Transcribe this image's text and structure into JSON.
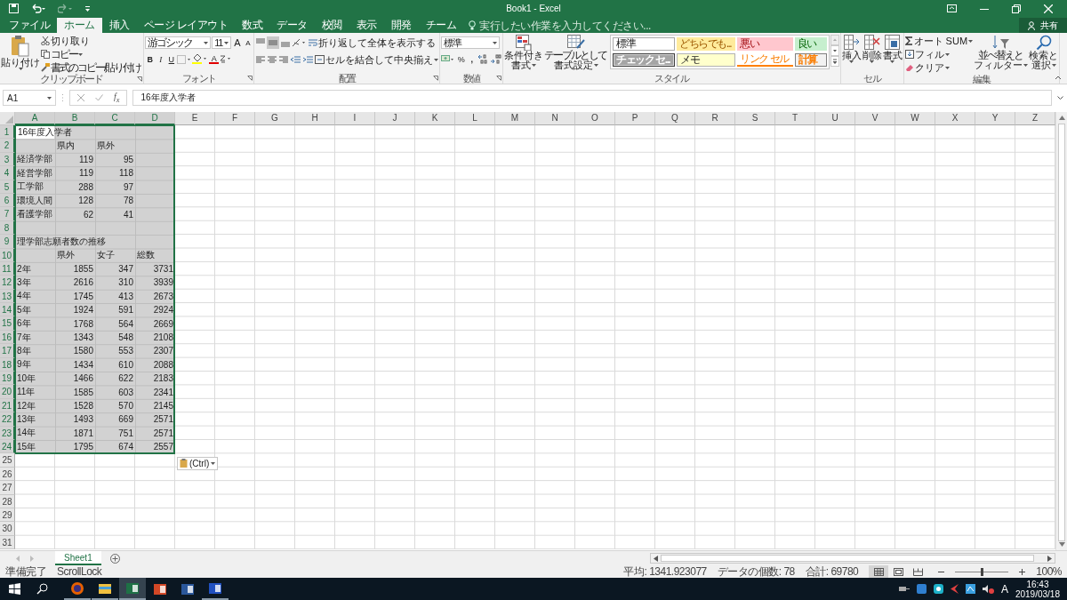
{
  "title_bar": {
    "title": "Book1 - Excel",
    "redo_disabled": true
  },
  "tabs": [
    {
      "label": "ファイル",
      "selected": false
    },
    {
      "label": "ホーム",
      "selected": true
    },
    {
      "label": "挿入",
      "selected": false
    },
    {
      "label": "ページ レイアウト",
      "selected": false
    },
    {
      "label": "数式",
      "selected": false
    },
    {
      "label": "データ",
      "selected": false
    },
    {
      "label": "校閲",
      "selected": false
    },
    {
      "label": "表示",
      "selected": false
    },
    {
      "label": "開発",
      "selected": false
    },
    {
      "label": "チーム",
      "selected": false
    }
  ],
  "tell_me": {
    "placeholder": "実行したい作業を入力してください..."
  },
  "share": {
    "label": "共有"
  },
  "ribbon": {
    "clipboard": {
      "label": "クリップボード",
      "paste": "貼り付け",
      "cut": "切り取り",
      "copy": "コピー",
      "format_painter": "書式のコピー/貼り付け"
    },
    "font": {
      "label": "フォント",
      "font_name": "游ゴシック",
      "font_size": "11",
      "grow": "A",
      "shrink": "A",
      "bold": "B",
      "italic": "I",
      "underline": "U",
      "font_color": "A"
    },
    "alignment": {
      "label": "配置",
      "wrap": "折り返して全体を表示する",
      "merge": "セルを結合して中央揃え"
    },
    "number": {
      "label": "数値",
      "format": "標準",
      "percent": "%",
      "comma": ","
    },
    "styles": {
      "label": "スタイル",
      "conditional": [
        "条件付き",
        "書式"
      ],
      "table": [
        "テーブルとして",
        "書式設定"
      ],
      "gallery": [
        {
          "label": "標準",
          "kind": "normal"
        },
        {
          "label": "どちらでも...",
          "kind": "neutral"
        },
        {
          "label": "悪い",
          "kind": "bad"
        },
        {
          "label": "良い",
          "kind": "good"
        },
        {
          "label": "チェック セ...",
          "kind": "check"
        },
        {
          "label": "メモ",
          "kind": "note"
        },
        {
          "label": "リンク セル",
          "kind": "link"
        },
        {
          "label": "計算",
          "kind": "calc"
        }
      ]
    },
    "cells": {
      "label": "セル",
      "buttons": [
        {
          "label": "挿入",
          "kind": "insert"
        },
        {
          "label": "削除",
          "kind": "delete"
        },
        {
          "label": "書式",
          "kind": "format"
        }
      ]
    },
    "editing": {
      "label": "編集",
      "autosum": "オート SUM",
      "fill": "フィル",
      "clear": "クリア",
      "sort": [
        "並べ替えと",
        "フィルター"
      ],
      "find": [
        "検索と",
        "選択"
      ]
    }
  },
  "formula_bar": {
    "name_box": "A1",
    "function_label": "f$_{x}$",
    "formula": "16年度入学者"
  },
  "sheet": {
    "columns": [
      {
        "label": "A",
        "selected": true
      },
      {
        "label": "B",
        "selected": true
      },
      {
        "label": "C",
        "selected": true
      },
      {
        "label": "D",
        "selected": true
      },
      {
        "label": "E",
        "selected": false
      },
      {
        "label": "F",
        "selected": false
      },
      {
        "label": "G",
        "selected": false
      },
      {
        "label": "H",
        "selected": false
      },
      {
        "label": "I",
        "selected": false
      },
      {
        "label": "J",
        "selected": false
      },
      {
        "label": "K",
        "selected": false
      },
      {
        "label": "L",
        "selected": false
      },
      {
        "label": "M",
        "selected": false
      },
      {
        "label": "N",
        "selected": false
      },
      {
        "label": "O",
        "selected": false
      },
      {
        "label": "P",
        "selected": false
      },
      {
        "label": "Q",
        "selected": false
      },
      {
        "label": "R",
        "selected": false
      },
      {
        "label": "S",
        "selected": false
      },
      {
        "label": "T",
        "selected": false
      },
      {
        "label": "U",
        "selected": false
      },
      {
        "label": "V",
        "selected": false
      },
      {
        "label": "W",
        "selected": false
      },
      {
        "label": "X",
        "selected": false
      },
      {
        "label": "Y",
        "selected": false
      },
      {
        "label": "Z",
        "selected": false
      }
    ],
    "rows": [
      {
        "header": "1",
        "selected": true,
        "cells": [
          {
            "text": "16年度入学者",
            "kind": "text",
            "active": true
          }
        ]
      },
      {
        "header": "2",
        "selected": true,
        "cells": [
          null,
          {
            "text": "県内",
            "kind": "text",
            "active": false
          },
          {
            "text": "県外",
            "kind": "text",
            "active": false
          }
        ]
      },
      {
        "header": "3",
        "selected": true,
        "cells": [
          {
            "text": "経済学部",
            "kind": "text",
            "active": false
          },
          {
            "text": "119",
            "kind": "number",
            "active": false
          },
          {
            "text": "95",
            "kind": "number",
            "active": false
          }
        ]
      },
      {
        "header": "4",
        "selected": true,
        "cells": [
          {
            "text": "経営学部",
            "kind": "text",
            "active": false
          },
          {
            "text": "119",
            "kind": "number",
            "active": false
          },
          {
            "text": "118",
            "kind": "number",
            "active": false
          }
        ]
      },
      {
        "header": "5",
        "selected": true,
        "cells": [
          {
            "text": "工学部",
            "kind": "text",
            "active": false
          },
          {
            "text": "288",
            "kind": "number",
            "active": false
          },
          {
            "text": "97",
            "kind": "number",
            "active": false
          }
        ]
      },
      {
        "header": "6",
        "selected": true,
        "cells": [
          {
            "text": "環境人間",
            "kind": "text",
            "active": false
          },
          {
            "text": "128",
            "kind": "number",
            "active": false
          },
          {
            "text": "78",
            "kind": "number",
            "active": false
          }
        ]
      },
      {
        "header": "7",
        "selected": true,
        "cells": [
          {
            "text": "看護学部",
            "kind": "text",
            "active": false
          },
          {
            "text": "62",
            "kind": "number",
            "active": false
          },
          {
            "text": "41",
            "kind": "number",
            "active": false
          }
        ]
      },
      {
        "header": "8",
        "selected": true
      },
      {
        "header": "9",
        "selected": true,
        "cells": [
          {
            "text": "理学部志願者数の推移",
            "kind": "text",
            "active": false
          }
        ]
      },
      {
        "header": "10",
        "selected": true,
        "cells": [
          null,
          {
            "text": "県外",
            "kind": "text",
            "active": false
          },
          {
            "text": "女子",
            "kind": "text",
            "active": false
          },
          {
            "text": "総数",
            "kind": "text",
            "active": false
          }
        ]
      },
      {
        "header": "11",
        "selected": true,
        "cells": [
          {
            "text": "2年",
            "kind": "text",
            "active": false
          },
          {
            "text": "1855",
            "kind": "number",
            "active": false
          },
          {
            "text": "347",
            "kind": "number",
            "active": false
          },
          {
            "text": "3731",
            "kind": "number",
            "active": false
          }
        ]
      },
      {
        "header": "12",
        "selected": true,
        "cells": [
          {
            "text": "3年",
            "kind": "text",
            "active": false
          },
          {
            "text": "2616",
            "kind": "number",
            "active": false
          },
          {
            "text": "310",
            "kind": "number",
            "active": false
          },
          {
            "text": "3939",
            "kind": "number",
            "active": false
          }
        ]
      },
      {
        "header": "13",
        "selected": true,
        "cells": [
          {
            "text": "4年",
            "kind": "text",
            "active": false
          },
          {
            "text": "1745",
            "kind": "number",
            "active": false
          },
          {
            "text": "413",
            "kind": "number",
            "active": false
          },
          {
            "text": "2673",
            "kind": "number",
            "active": false
          }
        ]
      },
      {
        "header": "14",
        "selected": true,
        "cells": [
          {
            "text": "5年",
            "kind": "text",
            "active": false
          },
          {
            "text": "1924",
            "kind": "number",
            "active": false
          },
          {
            "text": "591",
            "kind": "number",
            "active": false
          },
          {
            "text": "2924",
            "kind": "number",
            "active": false
          }
        ]
      },
      {
        "header": "15",
        "selected": true,
        "cells": [
          {
            "text": "6年",
            "kind": "text",
            "active": false
          },
          {
            "text": "1768",
            "kind": "number",
            "active": false
          },
          {
            "text": "564",
            "kind": "number",
            "active": false
          },
          {
            "text": "2669",
            "kind": "number",
            "active": false
          }
        ]
      },
      {
        "header": "16",
        "selected": true,
        "cells": [
          {
            "text": "7年",
            "kind": "text",
            "active": false
          },
          {
            "text": "1343",
            "kind": "number",
            "active": false
          },
          {
            "text": "548",
            "kind": "number",
            "active": false
          },
          {
            "text": "2108",
            "kind": "number",
            "active": false
          }
        ]
      },
      {
        "header": "17",
        "selected": true,
        "cells": [
          {
            "text": "8年",
            "kind": "text",
            "active": false
          },
          {
            "text": "1580",
            "kind": "number",
            "active": false
          },
          {
            "text": "553",
            "kind": "number",
            "active": false
          },
          {
            "text": "2307",
            "kind": "number",
            "active": false
          }
        ]
      },
      {
        "header": "18",
        "selected": true,
        "cells": [
          {
            "text": "9年",
            "kind": "text",
            "active": false
          },
          {
            "text": "1434",
            "kind": "number",
            "active": false
          },
          {
            "text": "610",
            "kind": "number",
            "active": false
          },
          {
            "text": "2088",
            "kind": "number",
            "active": false
          }
        ]
      },
      {
        "header": "19",
        "selected": true,
        "cells": [
          {
            "text": "10年",
            "kind": "text",
            "active": false
          },
          {
            "text": "1466",
            "kind": "number",
            "active": false
          },
          {
            "text": "622",
            "kind": "number",
            "active": false
          },
          {
            "text": "2183",
            "kind": "number",
            "active": false
          }
        ]
      },
      {
        "header": "20",
        "selected": true,
        "cells": [
          {
            "text": "11年",
            "kind": "text",
            "active": false
          },
          {
            "text": "1585",
            "kind": "number",
            "active": false
          },
          {
            "text": "603",
            "kind": "number",
            "active": false
          },
          {
            "text": "2341",
            "kind": "number",
            "active": false
          }
        ]
      },
      {
        "header": "21",
        "selected": true,
        "cells": [
          {
            "text": "12年",
            "kind": "text",
            "active": false
          },
          {
            "text": "1528",
            "kind": "number",
            "active": false
          },
          {
            "text": "570",
            "kind": "number",
            "active": false
          },
          {
            "text": "2145",
            "kind": "number",
            "active": false
          }
        ]
      },
      {
        "header": "22",
        "selected": true,
        "cells": [
          {
            "text": "13年",
            "kind": "text",
            "active": false
          },
          {
            "text": "1493",
            "kind": "number",
            "active": false
          },
          {
            "text": "669",
            "kind": "number",
            "active": false
          },
          {
            "text": "2571",
            "kind": "number",
            "active": false
          }
        ]
      },
      {
        "header": "23",
        "selected": true,
        "cells": [
          {
            "text": "14年",
            "kind": "text",
            "active": false
          },
          {
            "text": "1871",
            "kind": "number",
            "active": false
          },
          {
            "text": "751",
            "kind": "number",
            "active": false
          },
          {
            "text": "2571",
            "kind": "number",
            "active": false
          }
        ]
      },
      {
        "header": "24",
        "selected": true,
        "cells": [
          {
            "text": "15年",
            "kind": "text",
            "active": false
          },
          {
            "text": "1795",
            "kind": "number",
            "active": false
          },
          {
            "text": "674",
            "kind": "number",
            "active": false
          },
          {
            "text": "2557",
            "kind": "number",
            "active": false
          }
        ]
      },
      {
        "header": "25",
        "selected": false
      },
      {
        "header": "26",
        "selected": false
      },
      {
        "header": "27",
        "selected": false
      },
      {
        "header": "28",
        "selected": false
      },
      {
        "header": "29",
        "selected": false
      },
      {
        "header": "30",
        "selected": false
      },
      {
        "header": "31",
        "selected": false
      }
    ],
    "paste_options": {
      "label": "(Ctrl)"
    }
  },
  "sheet_tabs": [
    {
      "label": "Sheet1",
      "selected": true
    }
  ],
  "status_bar": {
    "ready": "準備完了",
    "scroll_lock": "ScrollLock",
    "average": "平均: 1341.923077",
    "count": "データの個数: 78",
    "sum": "合計: 69780",
    "views": [
      {
        "kind": "normal",
        "selected": true
      },
      {
        "kind": "page_layout",
        "selected": false
      },
      {
        "kind": "page_break",
        "selected": false
      }
    ],
    "zoom": {
      "level": 0.5,
      "label": "100%"
    }
  },
  "taskbar": {
    "apps": [
      {
        "kind": "firefox",
        "running": true,
        "active": false
      },
      {
        "kind": "explorer",
        "running": true,
        "active": false
      },
      {
        "kind": "excel",
        "running": true,
        "active": true
      },
      {
        "kind": "powerpoint",
        "running": false,
        "active": false
      },
      {
        "kind": "word",
        "running": false,
        "active": false
      },
      {
        "kind": "app",
        "running": true,
        "active": false
      }
    ],
    "ime": "A",
    "time": "16:43",
    "date": "2019/03/18"
  }
}
